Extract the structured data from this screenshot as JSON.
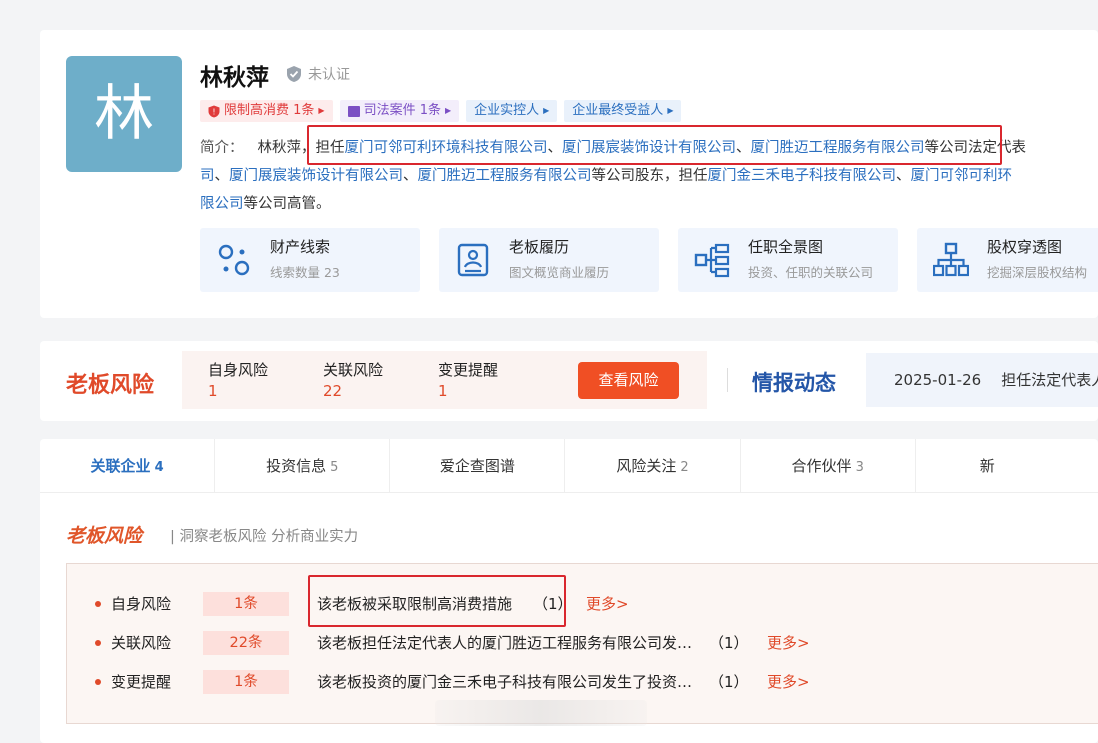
{
  "profile": {
    "avatar_char": "林",
    "name": "林秋萍",
    "verify_text": "未认证",
    "tags": [
      {
        "label": "限制高消费 1条",
        "icon": "shield-icon"
      },
      {
        "label": "司法案件 1条",
        "icon": "book-icon"
      },
      {
        "label": "企业实控人"
      },
      {
        "label": "企业最终受益人"
      }
    ],
    "intro": {
      "label": "简介：",
      "line1_pre": "林秋萍，担任",
      "line1_c1": "厦门可邻可利环境科技有限公司",
      "sep": "、",
      "line1_c2": "厦门展宸装饰设计有限公司",
      "line1_c3": "厦门胜迈工程服务有限公司",
      "line1_post": "等公司法定代表",
      "line2_c0": "司",
      "line2_c1": "厦门展宸装饰设计有限公司",
      "line2_c2": "厦门胜迈工程服务有限公司",
      "line2_mid": "等公司股东，担任",
      "line2_c3": "厦门金三禾电子科技有限公司",
      "line2_c4": "厦门可邻可利环",
      "line3_c0": "限公司",
      "line3_post": "等公司高管。"
    },
    "features": [
      {
        "title": "财产线索",
        "sub": "线索数量 23",
        "icon": "property-clue-icon"
      },
      {
        "title": "老板履历",
        "sub": "图文概览商业履历",
        "icon": "resume-icon"
      },
      {
        "title": "任职全景图",
        "sub": "投资、任职的关联公司",
        "icon": "org-chart-icon"
      },
      {
        "title": "股权穿透图",
        "sub": "挖掘深层股权结构",
        "icon": "equity-tree-icon"
      }
    ]
  },
  "risk_bar": {
    "title": "老板风险",
    "stats": [
      {
        "label": "自身风险",
        "value": "1"
      },
      {
        "label": "关联风险",
        "value": "22"
      },
      {
        "label": "变更提醒",
        "value": "1"
      }
    ],
    "button": "查看风险",
    "intel_title": "情报动态",
    "intel_date": "2025-01-26",
    "intel_text": "担任法定代表人"
  },
  "tabs": [
    {
      "label": "关联企业",
      "count": "4"
    },
    {
      "label": "投资信息",
      "count": "5"
    },
    {
      "label": "爱企查图谱",
      "count": ""
    },
    {
      "label": "风险关注",
      "count": "2"
    },
    {
      "label": "合作伙伴",
      "count": "3"
    },
    {
      "label": "新",
      "count": ""
    }
  ],
  "section": {
    "title": "老板风险",
    "subtitle": "| 洞察老板风险 分析商业实力"
  },
  "risk_items": [
    {
      "label": "自身风险",
      "count": "1条",
      "desc": "该老板被采取限制高消费措施",
      "num": "（1）",
      "more": "更多>"
    },
    {
      "label": "关联风险",
      "count": "22条",
      "desc": "该老板担任法定代表人的厦门胜迈工程服务有限公司发生了变更",
      "num": "（1）",
      "more": "更多>"
    },
    {
      "label": "变更提醒",
      "count": "1条",
      "desc": "该老板投资的厦门金三禾电子科技有限公司发生了投资变更",
      "num": "（1）",
      "more": "更多>"
    }
  ]
}
